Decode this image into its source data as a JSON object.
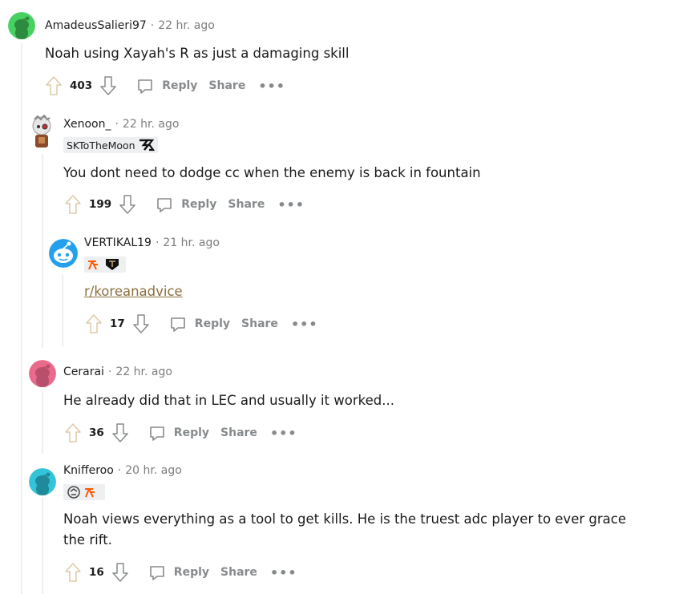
{
  "comments": [
    {
      "author": "AmadeusSalieri97",
      "time": "22 hr. ago",
      "body": "Noah using Xayah's R as just a damaging skill",
      "score": "403",
      "avatar_color": "#46d160"
    },
    {
      "author": "Xenoon_",
      "time": "22 hr. ago",
      "flair": "SKToTheMoon",
      "body": "You dont need to dodge cc when the enemy is back in fountain",
      "score": "199"
    },
    {
      "author": "VERTIKAL19",
      "time": "21 hr. ago",
      "body": "r/koreanadvice",
      "score": "17",
      "avatar_color": "#24a0ed"
    },
    {
      "author": "Cerarai",
      "time": "22 hr. ago",
      "body": "He already did that in LEC and usually it worked...",
      "score": "36",
      "avatar_color": "#ea6a8b"
    },
    {
      "author": "Knifferoo",
      "time": "20 hr. ago",
      "body_line1": "Noah views everything as a tool to get kills. He is the truest adc player to ever grace",
      "body_line2": "the rift.",
      "score": "16",
      "avatar_color": "#33c4d9"
    }
  ],
  "actions": {
    "reply": "Reply",
    "share": "Share",
    "more": "•••"
  },
  "separator": "·"
}
